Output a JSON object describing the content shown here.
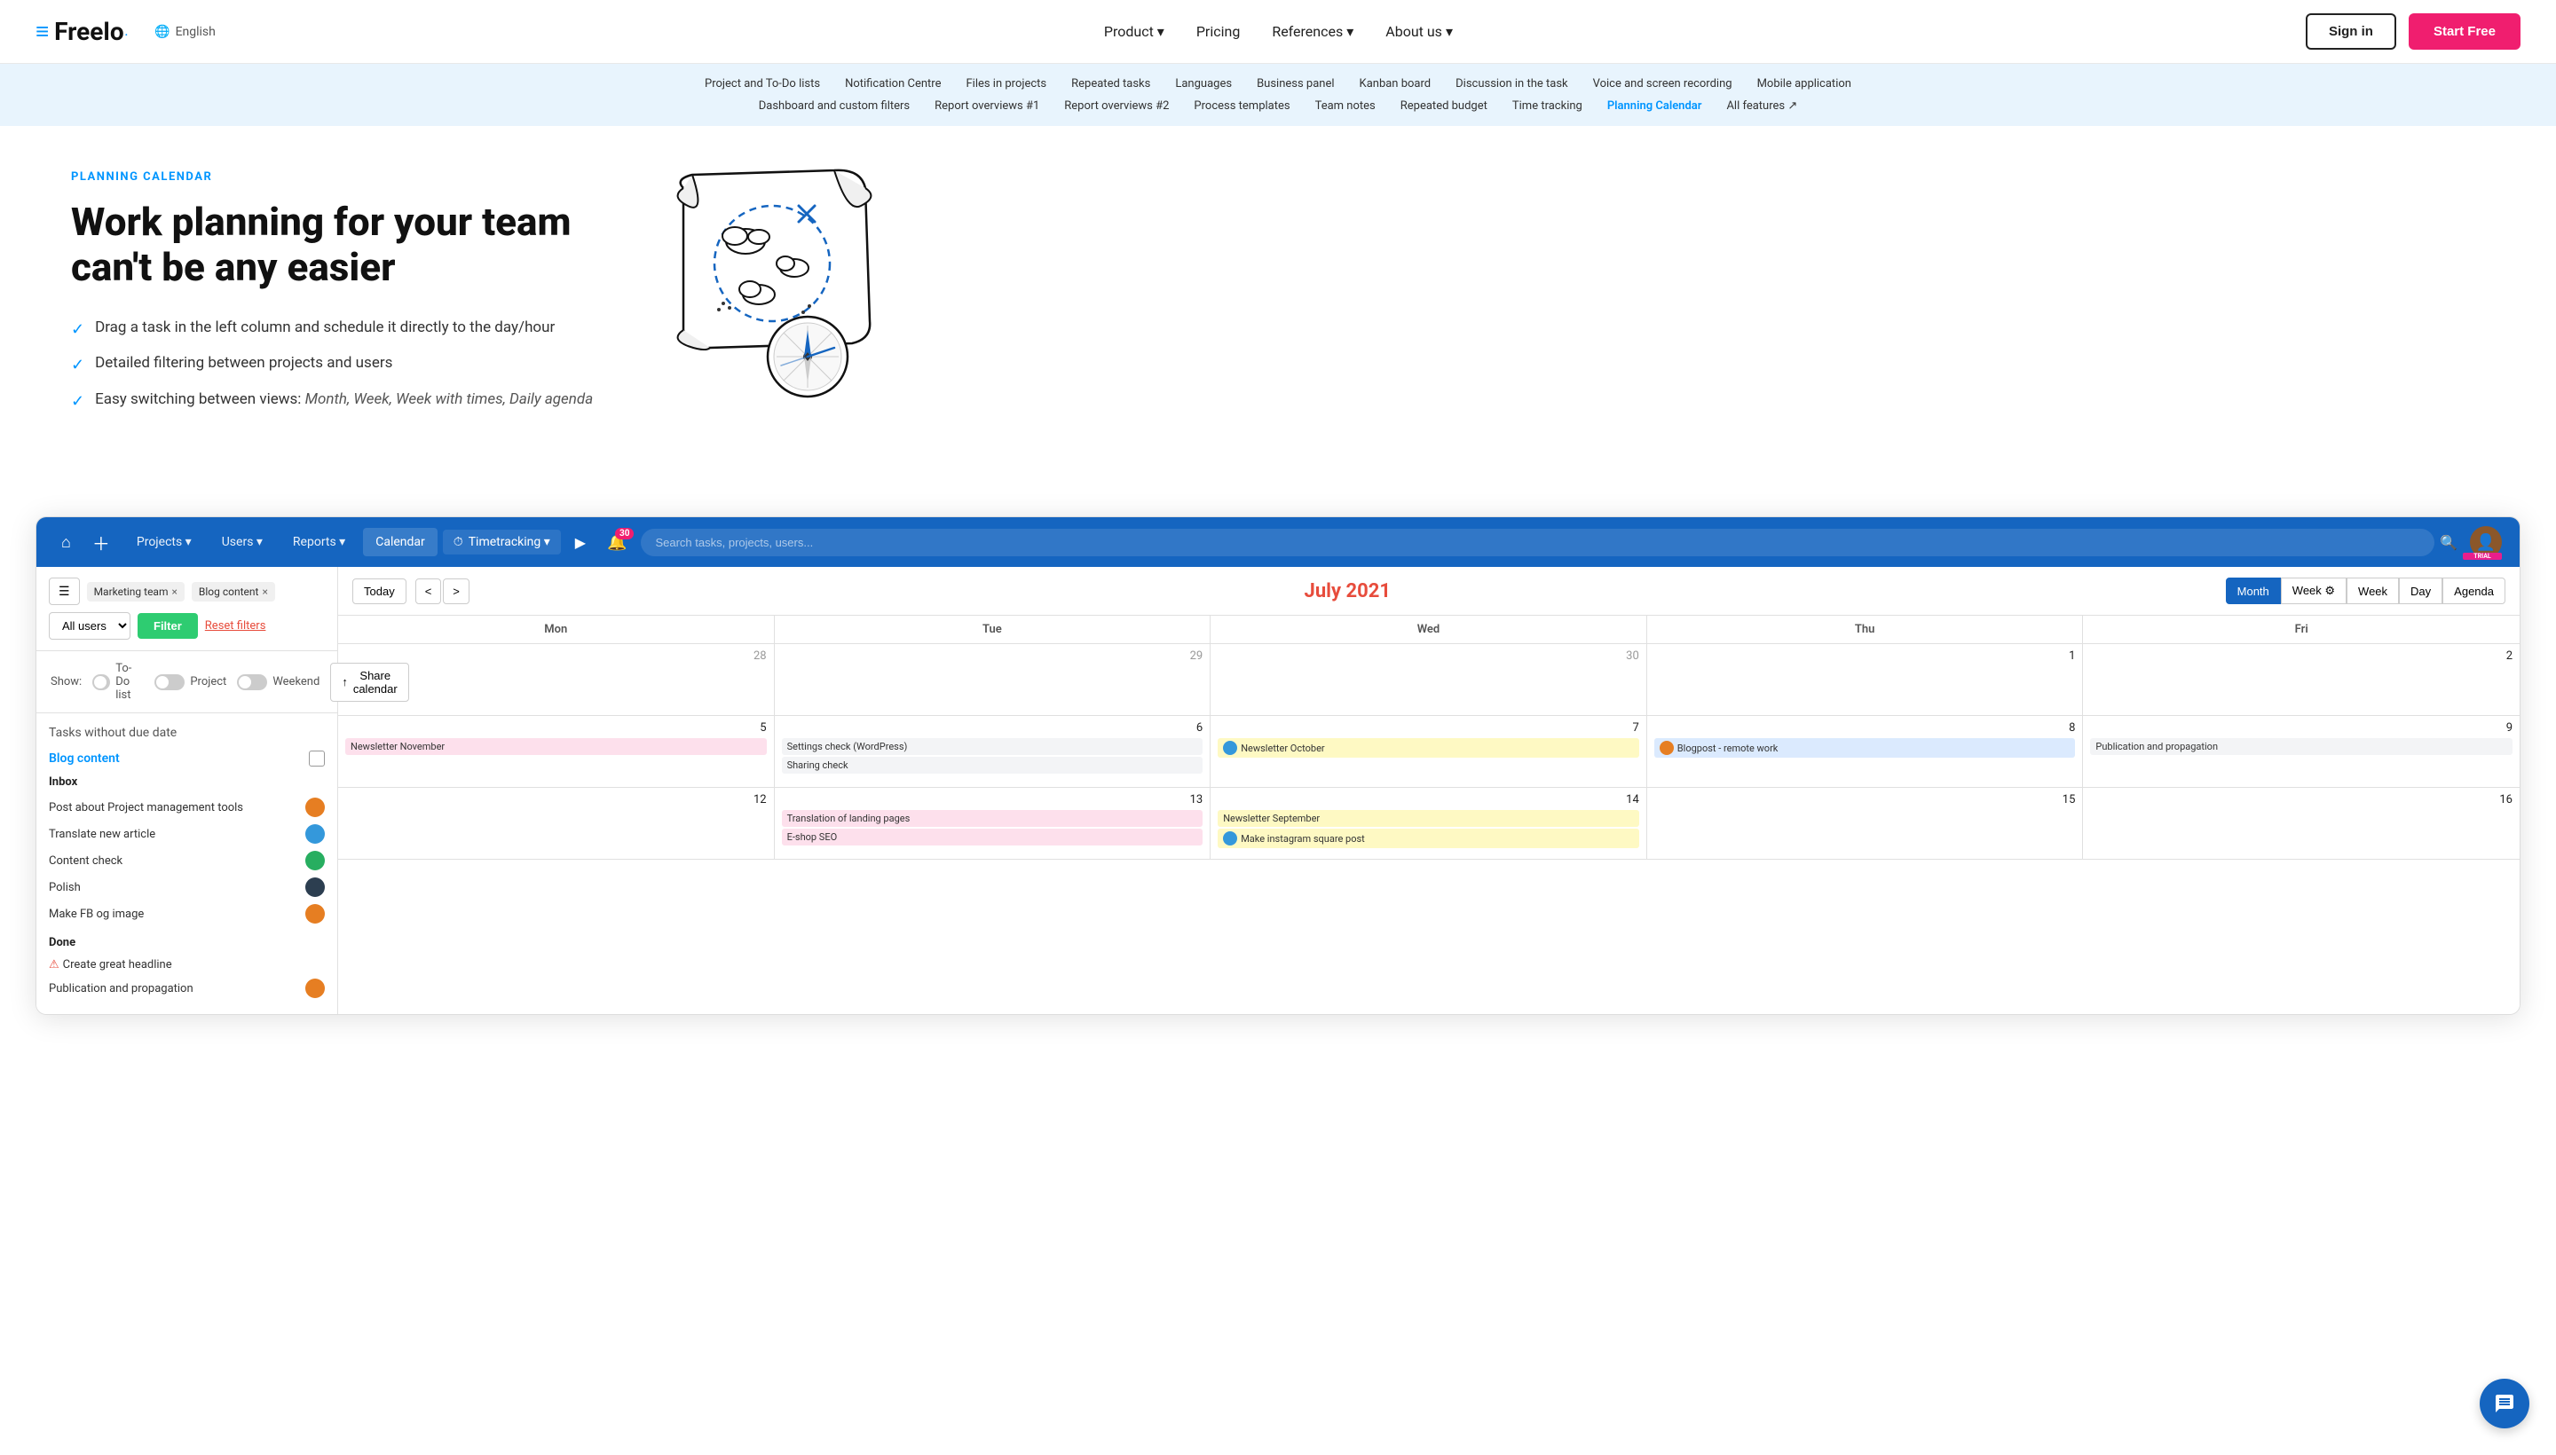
{
  "navbar": {
    "logo_text": "Freelo",
    "lang_label": "English",
    "nav_links": [
      {
        "label": "Product",
        "has_arrow": true
      },
      {
        "label": "Pricing",
        "has_arrow": false
      },
      {
        "label": "References",
        "has_arrow": true
      },
      {
        "label": "About us",
        "has_arrow": true
      }
    ],
    "signin_label": "Sign in",
    "start_label": "Start Free"
  },
  "feature_bar": {
    "row1": [
      {
        "label": "Project and To-Do lists",
        "highlight": false
      },
      {
        "label": "Notification Centre",
        "highlight": false
      },
      {
        "label": "Files in projects",
        "highlight": false
      },
      {
        "label": "Repeated tasks",
        "highlight": false
      },
      {
        "label": "Languages",
        "highlight": false
      },
      {
        "label": "Business panel",
        "highlight": false
      },
      {
        "label": "Kanban board",
        "highlight": false
      },
      {
        "label": "Discussion in the task",
        "highlight": false
      },
      {
        "label": "Voice and screen recording",
        "highlight": false
      },
      {
        "label": "Mobile application",
        "highlight": false
      }
    ],
    "row2": [
      {
        "label": "Dashboard and custom filters",
        "highlight": false
      },
      {
        "label": "Report overviews #1",
        "highlight": false
      },
      {
        "label": "Report overviews #2",
        "highlight": false
      },
      {
        "label": "Process templates",
        "highlight": false
      },
      {
        "label": "Team notes",
        "highlight": false
      },
      {
        "label": "Repeated budget",
        "highlight": false
      },
      {
        "label": "Time tracking",
        "highlight": false
      },
      {
        "label": "Planning Calendar",
        "highlight": true
      },
      {
        "label": "All features ↗",
        "highlight": false
      }
    ]
  },
  "hero": {
    "tag": "PLANNING CALENDAR",
    "title": "Work planning for your team can't be any easier",
    "features": [
      "Drag a task in the left column and schedule it directly to the day/hour",
      "Detailed filtering between projects and users",
      "Easy switching between views: Month, Week, Week with times, Daily agenda"
    ]
  },
  "app": {
    "nav_items": [
      "Projects ▾",
      "Users ▾",
      "Reports ▾",
      "Calendar",
      "⏱ Timetracking ▾"
    ],
    "play_btn": "▶",
    "search_placeholder": "Search tasks, projects, users...",
    "badge_count": "30",
    "trial_label": "TRIAL"
  },
  "calendar_toolbar": {
    "menu_icon": "☰",
    "filter_tags": [
      "Marketing team ×",
      "Blog content ×"
    ],
    "users_dropdown": "All users",
    "filter_btn": "Filter",
    "reset_label": "Reset filters"
  },
  "show_bar": {
    "show_label": "Show:",
    "toggle1_label": "To-Do list",
    "toggle2_label": "Project",
    "toggle3_label": "Weekend",
    "share_label": "Share calendar",
    "share_icon": "↑"
  },
  "calendar_header": {
    "today_label": "Today",
    "nav_prev": "<",
    "nav_next": ">",
    "month_title": "July 2021",
    "view_btns": [
      "Month",
      "Week ⚙",
      "Week",
      "Day",
      "Agenda"
    ],
    "active_view": "Month"
  },
  "calendar_days": [
    "Mon",
    "Tue",
    "Wed",
    "Thu",
    "Fri"
  ],
  "calendar_weeks": [
    {
      "cells": [
        {
          "date": "28",
          "active": false,
          "events": []
        },
        {
          "date": "29",
          "active": false,
          "events": []
        },
        {
          "date": "30",
          "active": false,
          "events": []
        },
        {
          "date": "1",
          "active": true,
          "events": []
        },
        {
          "date": "2",
          "active": true,
          "events": []
        }
      ]
    },
    {
      "cells": [
        {
          "date": "5",
          "active": true,
          "events": [
            {
              "text": "Newsletter November",
              "color": "pink"
            }
          ]
        },
        {
          "date": "6",
          "active": true,
          "events": [
            {
              "text": "Settings check (WordPress)",
              "color": "gray"
            },
            {
              "text": "Sharing check",
              "color": "gray"
            }
          ]
        },
        {
          "date": "7",
          "active": true,
          "events": [
            {
              "text": "Newsletter October",
              "color": "yellow",
              "avatar": true
            }
          ]
        },
        {
          "date": "8",
          "active": true,
          "events": [
            {
              "text": "Blogpost - remote work",
              "color": "blue",
              "avatar": true
            }
          ]
        },
        {
          "date": "9",
          "active": true,
          "events": [
            {
              "text": "Publication and propagation",
              "color": "gray"
            }
          ]
        }
      ]
    },
    {
      "cells": [
        {
          "date": "12",
          "active": true,
          "events": []
        },
        {
          "date": "13",
          "active": true,
          "events": [
            {
              "text": "Translation of landing pages",
              "color": "pink"
            },
            {
              "text": "E-shop SEO",
              "color": "pink"
            }
          ]
        },
        {
          "date": "14",
          "active": true,
          "events": [
            {
              "text": "Newsletter September",
              "color": "yellow"
            },
            {
              "text": "Make instagram square post",
              "color": "yellow",
              "avatar": true
            }
          ]
        },
        {
          "date": "15",
          "active": true,
          "events": []
        },
        {
          "date": "16",
          "active": true,
          "events": []
        }
      ]
    }
  ],
  "sidebar": {
    "tasks_title": "Tasks without due date",
    "project_label": "Blog content",
    "sections": [
      {
        "name": "Inbox",
        "tasks": [
          {
            "label": "Post about Project management tools",
            "avatar": true,
            "avatar_color": "orange"
          },
          {
            "label": "Translate new article",
            "avatar": true,
            "avatar_color": "blue"
          },
          {
            "label": "Content check",
            "avatar": true,
            "avatar_color": "green"
          },
          {
            "label": "Polish",
            "avatar": true,
            "avatar_color": "dark"
          },
          {
            "label": "Make FB og image",
            "avatar": true,
            "avatar_color": "orange"
          }
        ]
      },
      {
        "name": "Done",
        "tasks": [
          {
            "label": "Create great headline",
            "warn": true,
            "avatar": false
          },
          {
            "label": "Publication and propagation",
            "avatar": true,
            "avatar_color": "orange"
          }
        ]
      }
    ]
  }
}
